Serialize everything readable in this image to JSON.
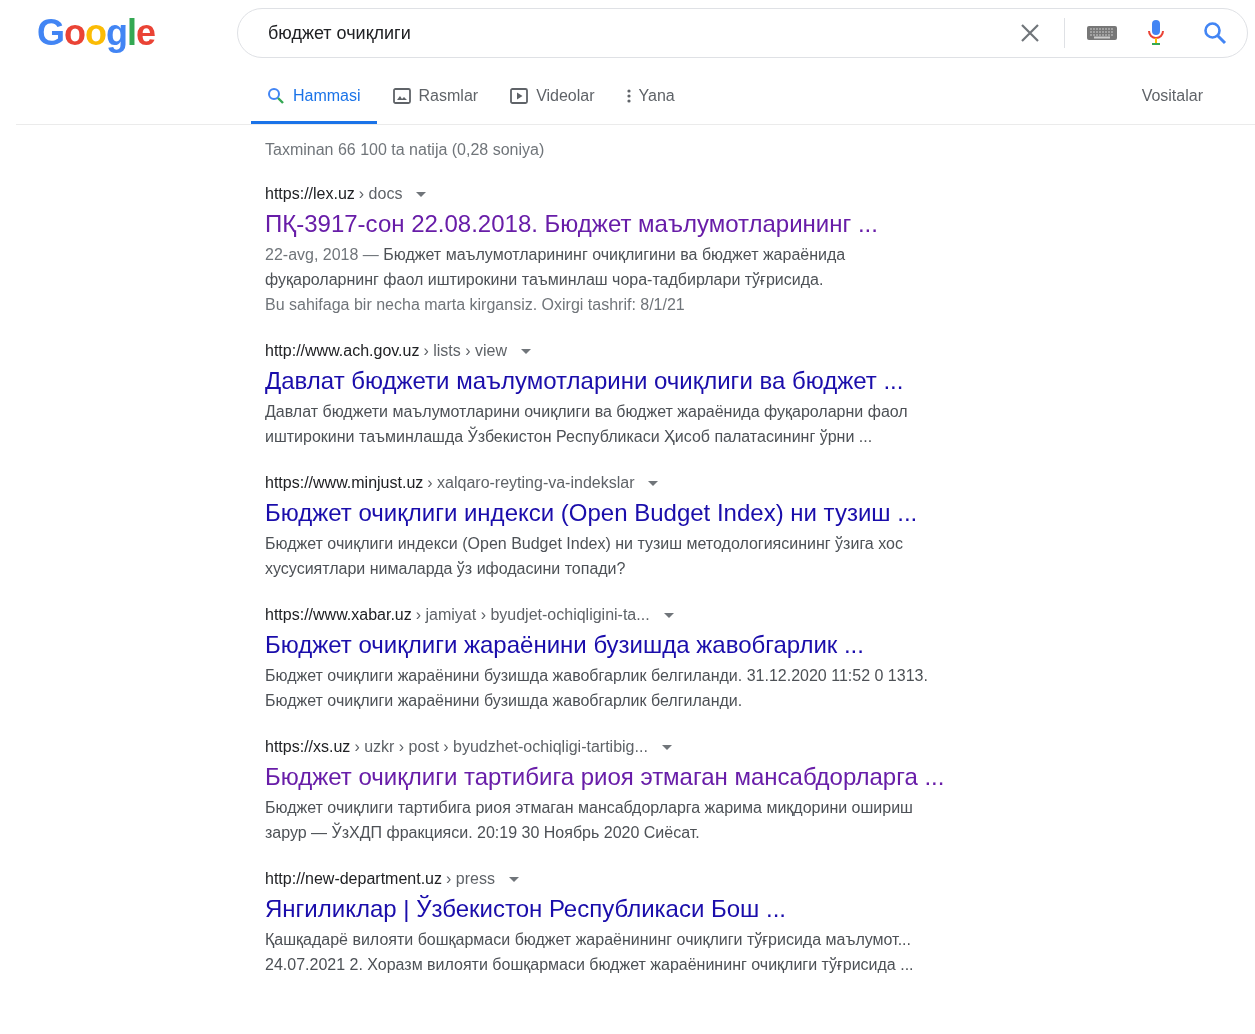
{
  "logo": "Google",
  "search": {
    "value": "бюджет очиқлиги"
  },
  "tabs": [
    {
      "label": "Hammasi",
      "kind": "all",
      "selected": true
    },
    {
      "label": "Rasmlar",
      "kind": "images",
      "selected": false
    },
    {
      "label": "Videolar",
      "kind": "videos",
      "selected": false
    },
    {
      "label": "Yana",
      "kind": "more",
      "selected": false
    }
  ],
  "tools_label": "Vositalar",
  "result_stats": "Taxminan 66 100 ta natija (0,28 soniya)",
  "results": [
    {
      "site": "https://lex.uz",
      "path": "› docs",
      "title": "ПҚ-3917-сон 22.08.2018. Бюджет маълумотларининг ...",
      "visited": true,
      "date": "22-avg, 2018 — ",
      "snippet_lines": [
        "Бюджет маълумотларининг очиқлигини ва бюджет жараёнида",
        "фуқароларнинг фаол иштирокини таъминлаш чора-тадбирлари тўғрисида."
      ],
      "visit_note": "Bu sahifaga bir necha marta kirgansiz. Oxirgi tashrif: 8/1/21"
    },
    {
      "site": "http://www.ach.gov.uz",
      "path": "› lists › view",
      "title": "Давлат бюджети маълумотларини очиқлиги ва бюджет ...",
      "visited": false,
      "snippet_lines": [
        "Давлат бюджети маълумотларини очиқлиги ва бюджет жараёнида фуқароларни фаол",
        "иштирокини таъминлашда Ўзбекистон Республикаси Ҳисоб палатасининг ўрни ..."
      ]
    },
    {
      "site": "https://www.minjust.uz",
      "path": "› xalqaro-reyting-va-indekslar",
      "title": "Бюджет очиқлиги индекси (Open Budget Index) ни тузиш ...",
      "visited": false,
      "snippet_lines": [
        "Бюджет очиқлиги индекси (Open Budget Index) ни тузиш методологиясининг ўзига хос",
        "хусусиятлари нималарда ўз ифодасини топади?"
      ]
    },
    {
      "site": "https://www.xabar.uz",
      "path": "› jamiyat › byudjet-ochiqligini-ta...",
      "title": "Бюджет очиқлиги жараёнини бузишда жавобгарлик ...",
      "visited": false,
      "snippet_lines": [
        "Бюджет очиқлиги жараёнини бузишда жавобгарлик белгиланди. 31.12.2020 11:52 0 1313.",
        "Бюджет очиқлиги жараёнини бузишда жавобгарлик белгиланди."
      ]
    },
    {
      "site": "https://xs.uz",
      "path": "› uzkr › post › byudzhet-ochiqligi-tartibig...",
      "title": "Бюджет очиқлиги тартибига риоя этмаган мансабдорларга ...",
      "visited": true,
      "snippet_lines": [
        "Бюджет очиқлиги тартибига риоя этмаган мансабдорларга жарима миқдорини ошириш",
        "зарур — ЎзХДП фракцияси. 20:19 30 Ноябрь 2020 Сиёсат."
      ]
    },
    {
      "site": "http://new-department.uz",
      "path": "› press",
      "title": "Янгиликлар | Ўзбекистон Республикаси Бош ...",
      "visited": false,
      "snippet_lines": [
        "Қашқадарё вилояти бошқармаси бюджет жараёнининг очиқлиги тўғрисида маълумот...",
        "24.07.2021 2. Хоразм вилояти бошқармаси бюджет жараёнининг очиқлиги тўғрисида ..."
      ]
    }
  ]
}
